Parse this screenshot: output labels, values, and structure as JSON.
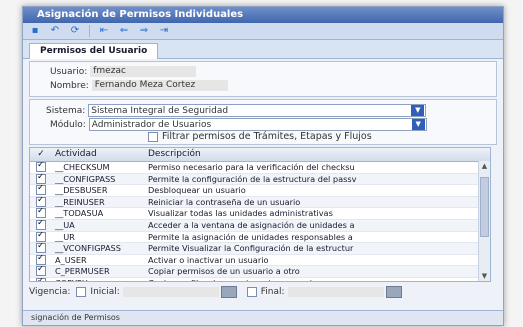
{
  "window": {
    "title": "Asignación de Permisos Individuales"
  },
  "toolbar": {
    "buttons": [
      {
        "name": "save",
        "glyph": "▪"
      },
      {
        "name": "undo",
        "glyph": "↶"
      },
      {
        "name": "refresh",
        "glyph": "⟳"
      },
      {
        "name": "first",
        "glyph": "⇤"
      },
      {
        "name": "previous",
        "glyph": "⇐"
      },
      {
        "name": "next",
        "glyph": "⇒"
      },
      {
        "name": "last",
        "glyph": "⇥"
      }
    ]
  },
  "tab": {
    "label": "Permisos del Usuario"
  },
  "user": {
    "usuario_label": "Usuario:",
    "usuario_value": "fmezac",
    "nombre_label": "Nombre:",
    "nombre_value": "Fernando Meza Cortez"
  },
  "filters": {
    "sistema_label": "Sistema:",
    "sistema_value": "Sistema Integral de Seguridad",
    "modulo_label": "Módulo:",
    "modulo_value": "Administrador de Usuarios",
    "filtrar_label": "Filtrar permisos de Trámites, Etapas y Flujos",
    "filtrar_checked": false
  },
  "grid": {
    "headers": [
      "✓",
      "Actividad",
      "Descripción"
    ],
    "rows": [
      {
        "checked": true,
        "actividad": "__CHECKSUM",
        "descripcion": "Permiso necesario para la verificación del checksu"
      },
      {
        "checked": true,
        "actividad": "__CONFIGPASS",
        "descripcion": "Permite la configuración de la estructura del passv"
      },
      {
        "checked": true,
        "actividad": "__DESBUSER",
        "descripcion": "Desbloquear un usuario"
      },
      {
        "checked": true,
        "actividad": "__REINUSER",
        "descripcion": "Reiniciar la contraseña de un usuario"
      },
      {
        "checked": true,
        "actividad": "__TODASUA",
        "descripcion": "Visualizar todas las unidades administrativas"
      },
      {
        "checked": true,
        "actividad": "__UA",
        "descripcion": "Acceder a la ventana de asignación de unidades a"
      },
      {
        "checked": true,
        "actividad": "__UR",
        "descripcion": "Permite la asignación de unidades responsables a"
      },
      {
        "checked": true,
        "actividad": "__VCONFIGPASS",
        "descripcion": "Permite Visualizar la Configuración de la estructur"
      },
      {
        "checked": true,
        "actividad": "A_USER",
        "descripcion": "Activar o inactivar un usuario"
      },
      {
        "checked": true,
        "actividad": "C_PERMUSER",
        "descripcion": "Copiar permisos de un usuario a otro"
      },
      {
        "checked": true,
        "actividad": "COPYPU",
        "descripcion": "Copiar perfiles de usuario a otros usuarios"
      }
    ]
  },
  "vigencia": {
    "label": "Vigencia:",
    "inicial_label": "Inicial:",
    "final_label": "Final:"
  },
  "status": {
    "text": "signación de Permisos"
  }
}
